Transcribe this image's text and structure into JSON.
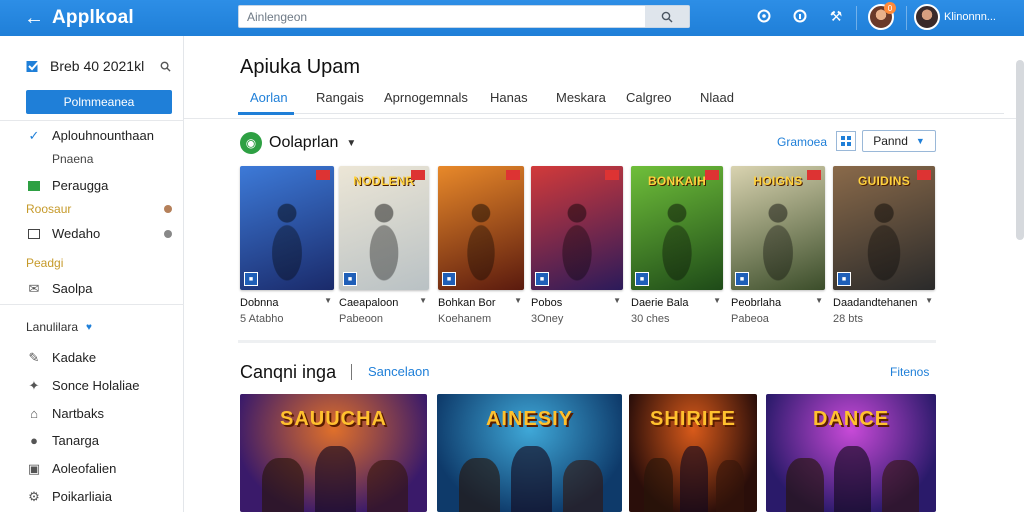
{
  "app": {
    "title": "Applkoal",
    "user_name": "Klinonnn...",
    "notification_count": "0"
  },
  "search": {
    "placeholder": "Ainlengeon"
  },
  "sidebar": {
    "header": "Breb 40 2021kl",
    "primary_button": "Polmmeanea",
    "items": [
      {
        "icon": "check-icon",
        "label": "Aplouhnounthaan",
        "sub": "Pnaena"
      },
      {
        "icon": "tag-icon",
        "label": "Peraugga"
      },
      {
        "section": "Roosaur"
      },
      {
        "icon": "square-icon",
        "label": "Wedaho"
      },
      {
        "section": "Peadgi"
      },
      {
        "icon": "mail-icon",
        "label": "Saolpa"
      }
    ],
    "section_library": "Lanulilara",
    "library": [
      {
        "icon": "edit-icon",
        "label": "Kadake"
      },
      {
        "icon": "gamepad-icon",
        "label": "Sonce Holaliae"
      },
      {
        "icon": "home-icon",
        "label": "Nartbaks"
      },
      {
        "icon": "user-icon",
        "label": "Tanarga"
      },
      {
        "icon": "robot-icon",
        "label": "Aoleofalien"
      },
      {
        "icon": "gear-icon",
        "label": "Poikarliaia"
      }
    ]
  },
  "main": {
    "title": "Apiuka Upam",
    "tabs": [
      "Aorlan",
      "Rangais",
      "Aprnogemnals",
      "Hanas",
      "Meskara",
      "Calgreo",
      "Nlaad"
    ],
    "section1": {
      "title": "Oolaprlan",
      "link": "Gramoea",
      "select": "Pannd",
      "cards": [
        {
          "cover": "",
          "title": "Dobnna",
          "meta": "5 Atabho",
          "c1": "#1a2a6a",
          "c2": "#3d7ad8"
        },
        {
          "cover": "NODLENR",
          "title": "Caeapaloon",
          "meta": "Pabeoon",
          "c1": "#b9c1c4",
          "c2": "#ece6d6"
        },
        {
          "cover": "",
          "title": "Bohkan Bor",
          "meta": "Koehanem",
          "c1": "#5a1a0e",
          "c2": "#e8892a"
        },
        {
          "cover": "",
          "title": "Pobos",
          "meta": "3Oney",
          "c1": "#2b1a5a",
          "c2": "#d23a3a"
        },
        {
          "cover": "BONKAIH",
          "title": "Daerie Bala",
          "meta": "30 ches",
          "c1": "#1e4a18",
          "c2": "#6fbf3a"
        },
        {
          "cover": "HOIGNS",
          "title": "Peobrlaha",
          "meta": "Pabeoa",
          "c1": "#3b4d2a",
          "c2": "#d9d3b0"
        },
        {
          "cover": "GUIDINS",
          "title": "Daadandtehanen",
          "meta": "28 bts",
          "c1": "#2a2a2a",
          "c2": "#8a6a4a"
        }
      ]
    },
    "section2": {
      "title": "Canqni inga",
      "subtitle": "Sancelaon",
      "link": "Fitenos",
      "banners": [
        {
          "title": "SAUUCHA",
          "c1": "#3a1a6a",
          "c2": "#e0702a"
        },
        {
          "title": "AINESIY",
          "c1": "#0e3a6a",
          "c2": "#3fa8d8"
        },
        {
          "title": "SHIRIFE",
          "c1": "#2a0e0a",
          "c2": "#d85a1a"
        },
        {
          "title": "DANCE",
          "c1": "#2a1a6a",
          "c2": "#c84ad8"
        }
      ]
    }
  }
}
